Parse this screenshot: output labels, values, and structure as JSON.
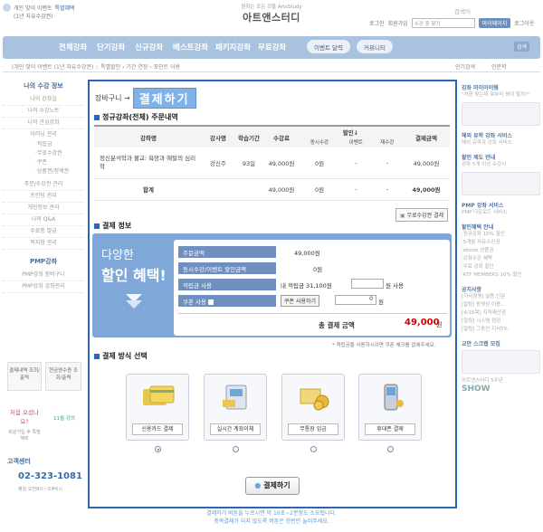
{
  "header": {
    "top_left_line1": "개인 맞이 이벤트",
    "top_left_badge": "특별혜택",
    "top_left_line2": "(1년 자유수강권)",
    "brand_sub": "원하는 모든 것을 ArtsStudy",
    "brand_name": "아트앤스터디",
    "link_login": "로그인",
    "link_join": "회원가입",
    "search_placeholder": "수강 중 찾기",
    "mypage": "마이페이지",
    "logout": "로그아웃"
  },
  "nav": {
    "items": [
      "전체강좌",
      "단기강좌",
      "신규강좌",
      "베스트강좌",
      "패키지강좌",
      "무료강좌"
    ],
    "event_btn": "이벤트 달력",
    "community_btn": "커뮤니티",
    "search_placeholder": "검색어",
    "search_btn": "검색"
  },
  "subbar": {
    "left": "(개인 맞이 이벤트 (1년 자유수강권) :: 특별할인 › 기간 연장 › 포인트 이용",
    "right1": "인기검색",
    "right2": "인문학"
  },
  "left_sidebar": {
    "section1": "나의 수강 정보",
    "items1": [
      "나의 강좌실",
      "나의 수강노트",
      "나의 관심강좌",
      "이러닝 관리"
    ],
    "sub_items": [
      "·적립금",
      "·무료수강권",
      "·쿠폰",
      "·상품권/정액권"
    ],
    "items2": [
      "주문/수강권 관리",
      "프린팅 관리",
      "개인정보 관리",
      "나의 Q&A",
      "수료증 발급",
      "쪽지함 관리"
    ],
    "section2": "PMP강좌",
    "items3": [
      "PMP강좌 장바구니",
      "PMP강좌 강좌관리"
    ],
    "boxes": [
      "결제내역 조회/출력",
      "현금영수증 조회/출력"
    ],
    "help_title": "처음 오셨나요?",
    "help_sub": "회원가입 후 특별 혜택",
    "help_badge": "11월 강의",
    "cc_title": "고객센터",
    "cc_phone": "02-323-1081",
    "cc_hours": "평일 오전9시~오후6시"
  },
  "right_sidebar": {
    "heads": [
      "강좌 마이아이템",
      "해외 유학 강좌 서비스",
      "할인 제도 안내",
      "PMP 강좌 서비스",
      "할인혜택 안내",
      "공지사항",
      "교안 스크랩 모집"
    ],
    "texts": [
      "\"처음 찾는데 뭐부터 봐야 할까?\"",
      "해외 유학과 강좌 서비스",
      "강좌 5개 이상 수강시",
      "PMP 다운로드 서비스",
      "·정규강좌 10% 할인",
      "·5개월 자유수강권",
      "·ebook 상품권",
      "·강좌수강 혜택",
      "·무료 강좌 할인",
      "·KTF MEMBERS 10% 할인"
    ],
    "notices": [
      "[지식경쟁] 실용 인문",
      "[알림] 동영상 이용..",
      "[4/16목] 지적재산권",
      "[알림] 시스템 점검",
      "[알림] 그동안 지식TV.."
    ],
    "bottom1": "아트앤스터디 5주년",
    "bottom2": "SHOW"
  },
  "main": {
    "crumb_prefix": "장바구니 →",
    "crumb_title": "결제하기",
    "order_section": "정규강좌(전체) 주문내역",
    "table": {
      "headers": [
        "강좌명",
        "강사명",
        "학습기간",
        "수강료",
        "할인",
        "결제금액"
      ],
      "sub_headers": [
        "동시수강",
        "이벤트",
        "재수강"
      ],
      "rows": [
        [
          "정신분석학과 불교: 욕망과 해탈의 심리학",
          "강신주",
          "93일",
          "49,000원",
          "0원",
          "-",
          "-",
          "49,000원"
        ]
      ],
      "total_label": "합계",
      "total": [
        "49,000원",
        "0원",
        "-",
        "-",
        "49,000원"
      ]
    },
    "free_btn": "무료수강권 결제",
    "payinfo_section": "결제 정보",
    "promo1": "다양한",
    "promo2": "할인 혜택!",
    "pay_rows": [
      {
        "label": "주문금액",
        "value": "49,000원"
      },
      {
        "label": "동시수강/이벤트 할인금액",
        "value": "0원"
      },
      {
        "label": "적립금 사용",
        "value": "내 적립금 31,100원"
      },
      {
        "label": "쿠폰 사용",
        "value": "쿠폰 사용하기"
      }
    ],
    "point_suffix": "원 사용",
    "coupon_value": "0",
    "coupon_suffix": "원",
    "total_label": "총 결제 금액",
    "total_value": "49,000",
    "total_unit": "원",
    "note": "* 적립금을 사용하시려면 쿠폰 체크를 없애주세요.",
    "method_section": "결제 방식 선택",
    "methods": [
      "신용카드 결제",
      "실시간 계좌이체",
      "무통장 입금",
      "휴대폰 결제"
    ],
    "pay_button": "결제하기",
    "footnote1": "결제하기 버튼을 누르시면 약 10초~2분정도 소요됩니다.",
    "footnote2": "중복결제가 되지 않도록 버튼은 한번만 눌러주세요."
  },
  "colors": {
    "accent": "#2a66b8",
    "nav": "#a9c2e0",
    "red": "#d10000",
    "panel": "#7fa8d8"
  }
}
